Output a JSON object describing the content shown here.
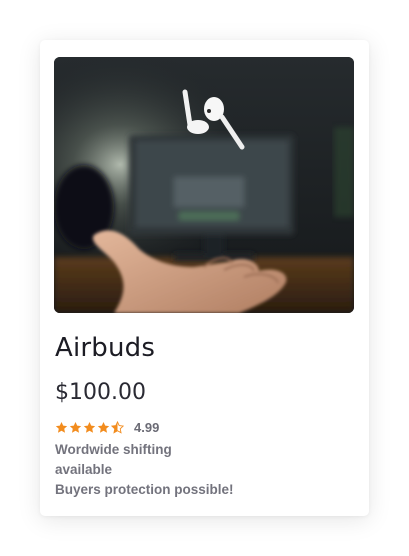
{
  "product": {
    "image_alt": "Airbuds image",
    "title": "Airbuds",
    "price": "$100.00",
    "rating": {
      "stars_value": 4.5,
      "stars_max": 5,
      "value_text": "4.99"
    },
    "shipping_line1": "Wordwide shifting",
    "shipping_line2": "available",
    "protection": "Buyers protection possible!"
  },
  "colors": {
    "star": "#f28c1e",
    "title": "#1c1c24",
    "muted": "#73737d"
  }
}
